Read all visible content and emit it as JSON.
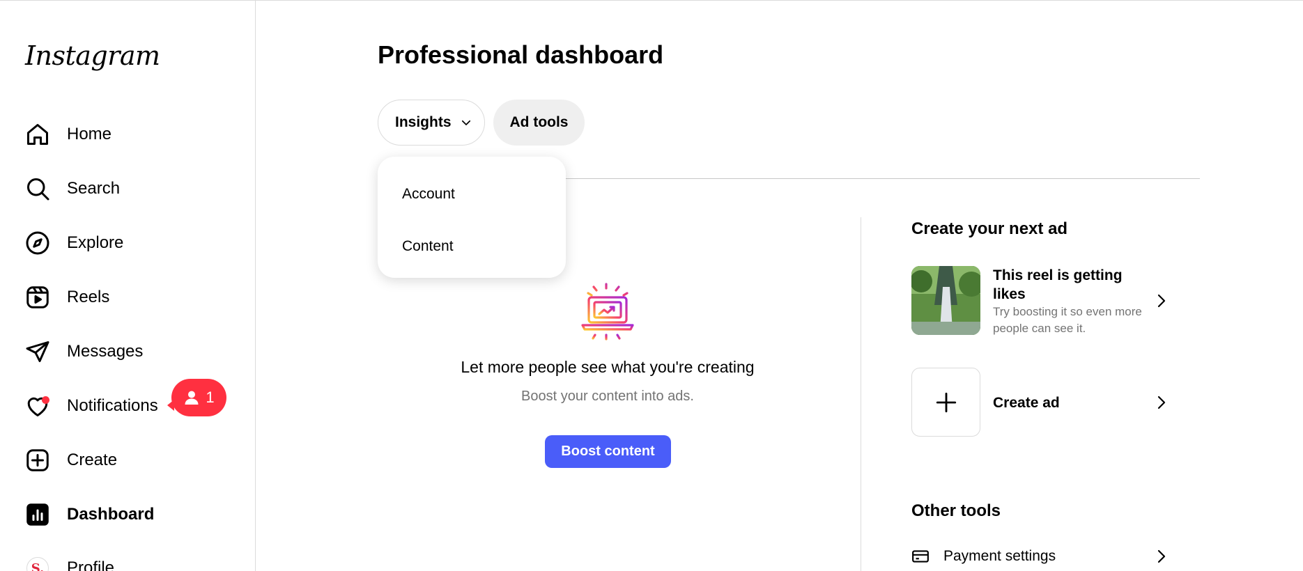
{
  "app": {
    "logo_text": "Instagram"
  },
  "sidebar": {
    "items": [
      {
        "label": "Home",
        "icon": "home-icon"
      },
      {
        "label": "Search",
        "icon": "search-icon"
      },
      {
        "label": "Explore",
        "icon": "compass-icon"
      },
      {
        "label": "Reels",
        "icon": "reels-icon"
      },
      {
        "label": "Messages",
        "icon": "send-icon"
      },
      {
        "label": "Notifications",
        "icon": "heart-icon"
      },
      {
        "label": "Create",
        "icon": "plus-square-icon"
      },
      {
        "label": "Dashboard",
        "icon": "dashboard-icon"
      },
      {
        "label": "Profile",
        "icon": "avatar"
      }
    ],
    "active": "Dashboard",
    "notification_badge": {
      "count": "1",
      "color": "#ff3040"
    },
    "profile_avatar_letter": "S."
  },
  "main": {
    "title": "Professional dashboard",
    "tabs": {
      "insights_label": "Insights",
      "adtools_label": "Ad tools"
    },
    "dropdown": {
      "items": [
        "Account",
        "Content"
      ]
    },
    "empty_state": {
      "title": "Let more people see what you're creating",
      "subtitle": "Boost your content into ads.",
      "button_label": "Boost content",
      "button_color": "#4a5df9"
    }
  },
  "right": {
    "create_section_title": "Create your next ad",
    "reel_card": {
      "title": "This reel is getting likes",
      "subtitle": "Try boosting it so even more people can see it."
    },
    "create_ad_label": "Create ad",
    "other_tools_title": "Other tools",
    "tools": [
      {
        "label": "Payment settings",
        "icon": "card-icon"
      }
    ]
  }
}
